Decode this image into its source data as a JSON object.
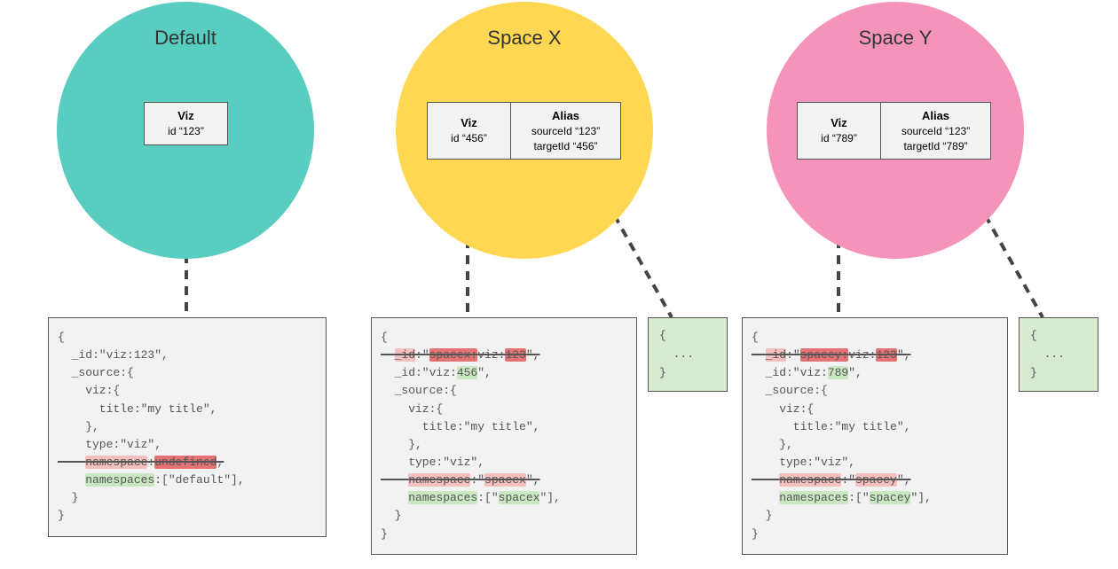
{
  "spaces": [
    {
      "title": "Default",
      "color": "#58cdc0",
      "cards": [
        {
          "name": "Viz",
          "lines": [
            "id “123”"
          ]
        }
      ],
      "code": {
        "lines": [
          {
            "t": "{"
          },
          {
            "t": "  _id:\"viz:123\","
          },
          {
            "t": "  _source:{"
          },
          {
            "t": "    viz:{"
          },
          {
            "t": "      title:\"my title\","
          },
          {
            "t": "    },"
          },
          {
            "t": "    type:\"viz\","
          },
          {
            "strike": true,
            "segs": [
              {
                "txt": "    "
              },
              {
                "txt": "namespace",
                "cls": "hl-red-lt"
              },
              {
                "txt": ":"
              },
              {
                "txt": "undefined",
                "cls": "hl-red-dk"
              },
              {
                "txt": ","
              }
            ]
          },
          {
            "segs": [
              {
                "txt": "    "
              },
              {
                "txt": "namespaces",
                "cls": "hl-green"
              },
              {
                "txt": ":[\"default\"],"
              }
            ]
          },
          {
            "t": "  }"
          },
          {
            "t": "}"
          }
        ]
      }
    },
    {
      "title": "Space X",
      "color": "#ffd752",
      "cards": [
        {
          "name": "Viz",
          "lines": [
            "id “456”"
          ]
        },
        {
          "name": "Alias",
          "lines": [
            "sourceId “123”",
            "targetId “456”"
          ]
        }
      ],
      "code": {
        "lines": [
          {
            "t": "{"
          },
          {
            "strike": true,
            "segs": [
              {
                "txt": "  "
              },
              {
                "txt": "_id",
                "cls": "hl-red-lt"
              },
              {
                "txt": ":\""
              },
              {
                "txt": "spacex:",
                "cls": "hl-red-dk"
              },
              {
                "txt": "viz:"
              },
              {
                "txt": "123",
                "cls": "hl-red-dk"
              },
              {
                "txt": "\","
              }
            ]
          },
          {
            "segs": [
              {
                "txt": "  _id:\"viz:"
              },
              {
                "txt": "456",
                "cls": "hl-green"
              },
              {
                "txt": "\","
              }
            ]
          },
          {
            "t": "  _source:{"
          },
          {
            "t": "    viz:{"
          },
          {
            "t": "      title:\"my title\","
          },
          {
            "t": "    },"
          },
          {
            "t": "    type:\"viz\","
          },
          {
            "strike": true,
            "segs": [
              {
                "txt": "    "
              },
              {
                "txt": "namespace",
                "cls": "hl-red-lt"
              },
              {
                "txt": ":\""
              },
              {
                "txt": "spacex",
                "cls": "hl-red-lt"
              },
              {
                "txt": "\","
              }
            ]
          },
          {
            "segs": [
              {
                "txt": "    "
              },
              {
                "txt": "namespaces",
                "cls": "hl-green"
              },
              {
                "txt": ":[\""
              },
              {
                "txt": "spacex",
                "cls": "hl-green"
              },
              {
                "txt": "\"],"
              }
            ]
          },
          {
            "t": "  }"
          },
          {
            "t": "}"
          }
        ]
      },
      "alias_code": "{\n  ...\n}"
    },
    {
      "title": "Space Y",
      "color": "#f594bb",
      "cards": [
        {
          "name": "Viz",
          "lines": [
            "id “789”"
          ]
        },
        {
          "name": "Alias",
          "lines": [
            "sourceId “123”",
            "targetId “789”"
          ]
        }
      ],
      "code": {
        "lines": [
          {
            "t": "{"
          },
          {
            "strike": true,
            "segs": [
              {
                "txt": "  "
              },
              {
                "txt": "_id",
                "cls": "hl-red-lt"
              },
              {
                "txt": ":\""
              },
              {
                "txt": "spacey:",
                "cls": "hl-red-dk"
              },
              {
                "txt": "viz:"
              },
              {
                "txt": "123",
                "cls": "hl-red-dk"
              },
              {
                "txt": "\","
              }
            ]
          },
          {
            "segs": [
              {
                "txt": "  _id:\"viz:"
              },
              {
                "txt": "789",
                "cls": "hl-green"
              },
              {
                "txt": "\","
              }
            ]
          },
          {
            "t": "  _source:{"
          },
          {
            "t": "    viz:{"
          },
          {
            "t": "      title:\"my title\","
          },
          {
            "t": "    },"
          },
          {
            "t": "    type:\"viz\","
          },
          {
            "strike": true,
            "segs": [
              {
                "txt": "    "
              },
              {
                "txt": "namespace",
                "cls": "hl-red-lt"
              },
              {
                "txt": ":\""
              },
              {
                "txt": "spacey",
                "cls": "hl-red-lt"
              },
              {
                "txt": "\","
              }
            ]
          },
          {
            "segs": [
              {
                "txt": "    "
              },
              {
                "txt": "namespaces",
                "cls": "hl-green"
              },
              {
                "txt": ":[\""
              },
              {
                "txt": "spacey",
                "cls": "hl-green"
              },
              {
                "txt": "\"],"
              }
            ]
          },
          {
            "t": "  }"
          },
          {
            "t": "}"
          }
        ]
      },
      "alias_code": "{\n  ...\n}"
    }
  ]
}
